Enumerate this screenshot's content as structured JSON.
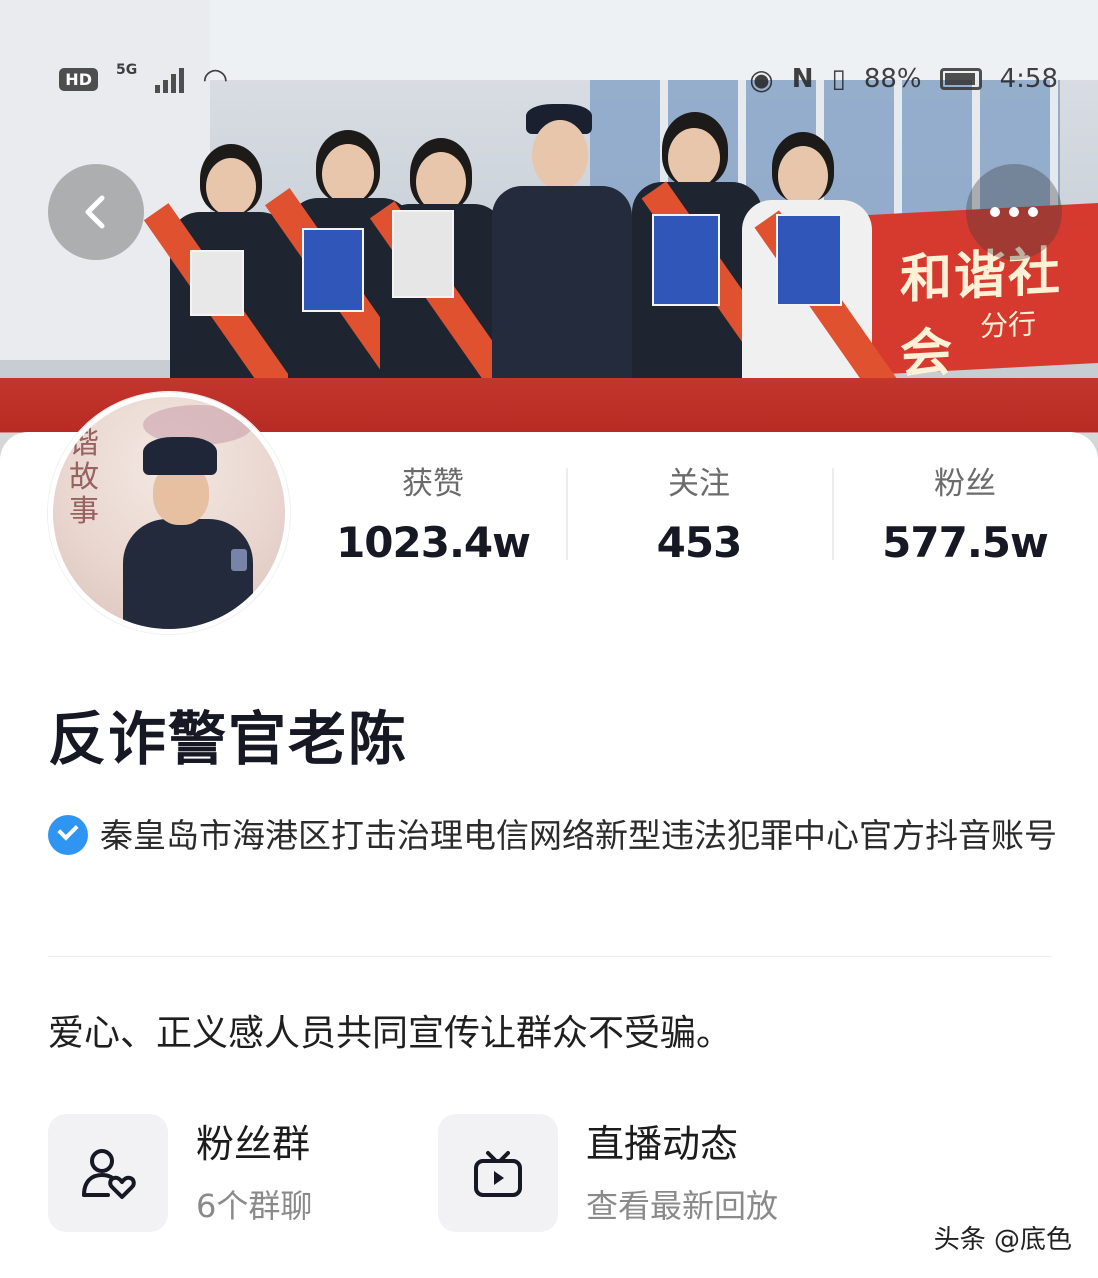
{
  "status_bar": {
    "hd_label": "HD",
    "network": "5G",
    "battery_percent": "88%",
    "time": "4:58"
  },
  "banner": {
    "sign_text": "和谐社会",
    "sign_subtext": "分行"
  },
  "profile": {
    "stats": [
      {
        "label": "获赞",
        "value": "1023.4w"
      },
      {
        "label": "关注",
        "value": "453"
      },
      {
        "label": "粉丝",
        "value": "577.5w"
      }
    ],
    "nickname": "反诈警官老陈",
    "verification": "秦皇岛市海港区打击治理电信网络新型违法犯罪中心官方抖音账号",
    "bio": "爱心、正义感人员共同宣传让群众不受骗。"
  },
  "entries": {
    "fans_group": {
      "title": "粉丝群",
      "subtitle": "6个群聊",
      "icon": "user-heart-icon"
    },
    "live": {
      "title": "直播动态",
      "subtitle": "查看最新回放",
      "icon": "tv-play-icon"
    }
  },
  "avatar_calligraphy": "谐故事",
  "watermark": "头条 @底色",
  "colors": {
    "verify_blue": "#2f95f2",
    "text_primary": "#161823",
    "text_secondary": "#8a8a8a"
  }
}
